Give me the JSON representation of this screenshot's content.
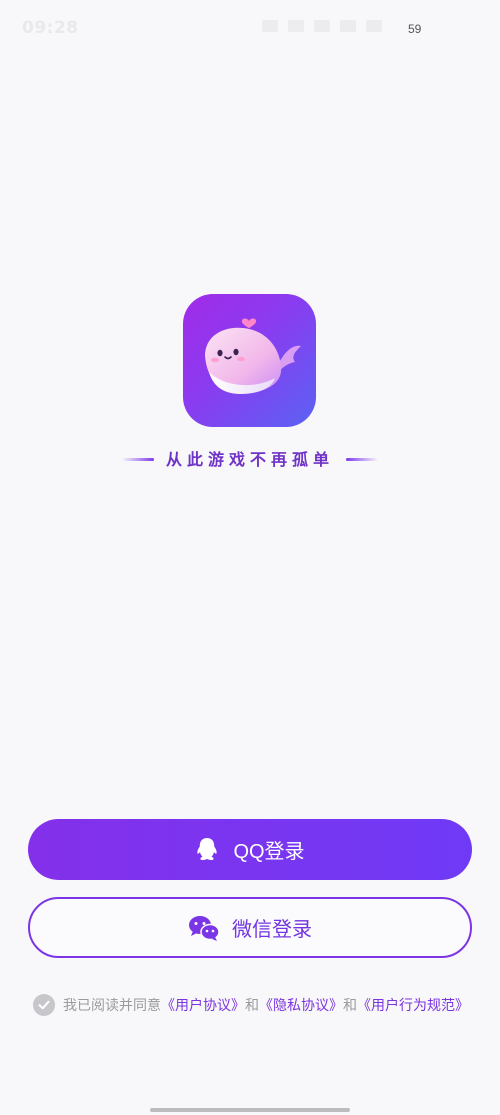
{
  "status_bar": {
    "time": "09:28",
    "battery": "59"
  },
  "brand": {
    "slogan": "从此游戏不再孤单",
    "accent_color": "#7c3aed"
  },
  "login": {
    "qq_label": "QQ登录",
    "qq_icon": "qq-penguin-icon",
    "wechat_label": "微信登录",
    "wechat_icon": "wechat-icon"
  },
  "agreement": {
    "prefix": "我已阅读并同意",
    "user_agreement": "《用户协议》",
    "and_1": "和",
    "privacy_agreement": "《隐私协议》",
    "and_2": "和",
    "conduct_rules": "《用户行为规范》",
    "checked": true
  }
}
